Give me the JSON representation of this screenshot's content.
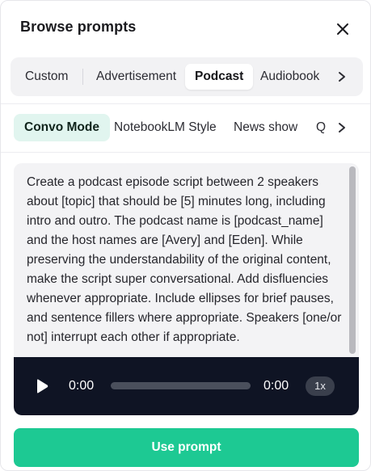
{
  "header": {
    "title": "Browse prompts",
    "close_icon": "close-icon"
  },
  "tabs": {
    "items": [
      {
        "label": "Custom",
        "selected": false
      },
      {
        "label": "Advertisement",
        "selected": false
      },
      {
        "label": "Podcast",
        "selected": true
      },
      {
        "label": "Audiobook",
        "selected": false
      }
    ],
    "more_icon": "chevron-right-icon"
  },
  "styles": {
    "items": [
      {
        "label": "Convo Mode",
        "selected": true
      },
      {
        "label": "NotebookLM Style",
        "selected": false
      },
      {
        "label": "News show",
        "selected": false
      },
      {
        "label": "Q",
        "selected": false
      }
    ],
    "more_icon": "chevron-right-icon"
  },
  "prompt": {
    "text": "Create a podcast episode script between 2 speakers about [topic] that should be [5] minutes long, including intro and outro. The podcast name is [podcast_name] and the host names are [Avery] and [Eden]. While preserving the understandability of the original content, make the script super conversational. Add disfluencies whenever appropriate. Include ellipses for brief pauses, and sentence fillers where appropriate. Speakers [one/or not] interrupt each other if appropriate."
  },
  "player": {
    "current_time": "0:00",
    "duration": "0:00",
    "speed": "1x",
    "progress": 0,
    "play_icon": "play-icon"
  },
  "action": {
    "use_label": "Use prompt"
  },
  "colors": {
    "accent": "#1dc993",
    "selected_chip_bg": "#e1f5ef",
    "player_bg": "#0f1424",
    "tab_bar_bg": "#f2f2f4"
  }
}
